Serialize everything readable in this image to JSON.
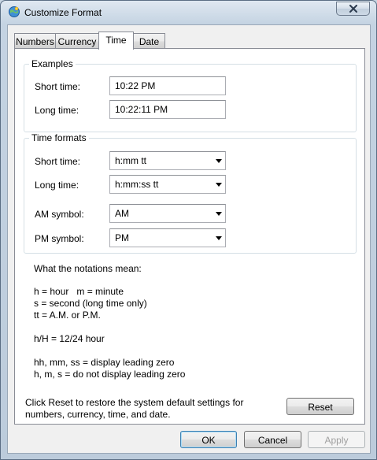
{
  "window": {
    "title": "Customize Format",
    "close_glyph": "✕"
  },
  "tabs": [
    {
      "label": "Numbers",
      "selected": false
    },
    {
      "label": "Currency",
      "selected": false
    },
    {
      "label": "Time",
      "selected": true
    },
    {
      "label": "Date",
      "selected": false
    }
  ],
  "examples": {
    "title": "Examples",
    "short_label": "Short time:",
    "short_value": "10:22 PM",
    "long_label": "Long time:",
    "long_value": "10:22:11 PM"
  },
  "formats": {
    "title": "Time formats",
    "short_label": "Short time:",
    "short_value": "h:mm tt",
    "long_label": "Long time:",
    "long_value": "h:mm:ss tt",
    "am_label": "AM symbol:",
    "am_value": "AM",
    "pm_label": "PM symbol:",
    "pm_value": "PM"
  },
  "notes": {
    "heading": "What the notations mean:",
    "line1": "h = hour   m = minute",
    "line2": "s = second (long time only)",
    "line3": "tt = A.M. or P.M.",
    "line4": "h/H = 12/24 hour",
    "line5": "hh, mm, ss = display leading zero",
    "line6": "h, m, s = do not display leading zero"
  },
  "reset": {
    "text_line1": "Click Reset to restore the system default settings for",
    "text_line2": "numbers, currency, time, and date.",
    "button": "Reset"
  },
  "footer": {
    "ok": "OK",
    "cancel": "Cancel",
    "apply": "Apply"
  },
  "icons": {
    "app": "regional-settings-icon",
    "close": "close-icon",
    "dropdown": "chevron-down-icon"
  }
}
